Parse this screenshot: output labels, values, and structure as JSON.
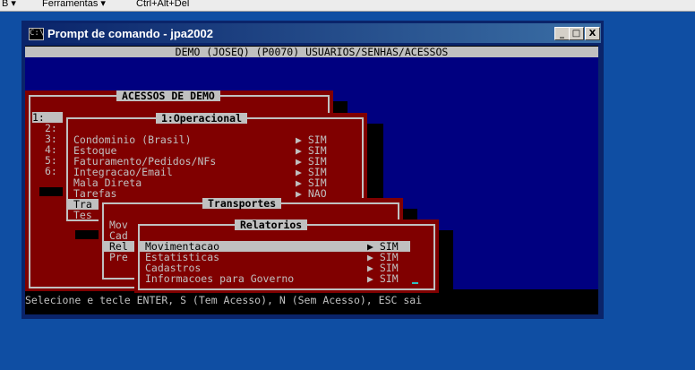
{
  "topbar": {
    "left_fragment": "B ▾",
    "ferramentas": "Ferramentas ▾",
    "shortcut": "Ctrl+Alt+Del"
  },
  "window": {
    "title": "Prompt de comando - jpa2002",
    "icon_text": "C:\\",
    "min": "_",
    "max": "□",
    "close": "X"
  },
  "console": {
    "header": "DEMO (JOSEQ) (P0070) USUARIOS/SENHAS/ACESSOS",
    "status": "Selecione e tecle ENTER, S (Tem Acesso), N (Sem Acesso), ESC sai"
  },
  "demo_menu": {
    "title": "ACESSOS DE DEMO",
    "items": [
      "1:",
      "2:",
      "3:",
      "4:",
      "5:",
      "6:"
    ]
  },
  "operacional_menu": {
    "title": "1:Operacional",
    "items": [
      {
        "label": "Condominio (Brasil)",
        "value": "▶ SIM"
      },
      {
        "label": "Estoque",
        "value": "▶ SIM"
      },
      {
        "label": "Faturamento/Pedidos/NFs",
        "value": "▶ SIM"
      },
      {
        "label": "Integracao/Email",
        "value": "▶ SIM"
      },
      {
        "label": "Mala Direta",
        "value": "▶ SIM"
      },
      {
        "label": "Tarefas",
        "value": "▶ NAO"
      },
      {
        "label": "Tra"
      },
      {
        "label": "Tes"
      }
    ]
  },
  "transportes_menu": {
    "title": "Transportes",
    "items": [
      "Mov",
      "Cad",
      "Rel",
      "Pre"
    ]
  },
  "relatorios_menu": {
    "title": "Relatorios",
    "items": [
      {
        "label": "Movimentacao",
        "value": "▶ SIM"
      },
      {
        "label": "Estatisticas",
        "value": "▶ SIM"
      },
      {
        "label": "Cadastros",
        "value": "▶ SIM"
      },
      {
        "label": "Informacoes para Governo",
        "value": "▶ SIM"
      }
    ]
  },
  "colors": {
    "console_bg": "#000080",
    "menu_bg": "#800000",
    "menu_text": "#c0c0c0",
    "desktop": "#0f4ea3"
  }
}
